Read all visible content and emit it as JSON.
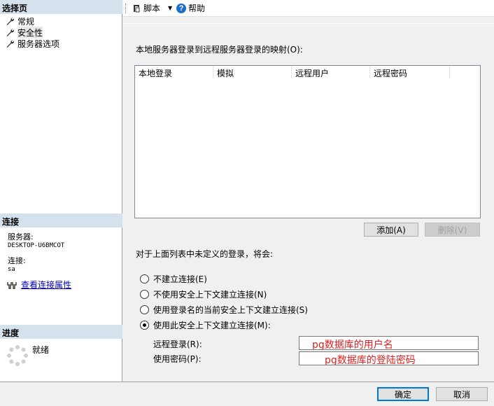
{
  "left_pane": {
    "select_page_title": "选择页",
    "pages": [
      {
        "label": "常规"
      },
      {
        "label": "安全性"
      },
      {
        "label": "服务器选项"
      }
    ],
    "connection": {
      "title": "连接",
      "server_label": "服务器:",
      "server_value": "DESKTOP-U6BMCOT",
      "conn_label": "连接:",
      "conn_value": "sa",
      "view_props_link": "查看连接属性"
    },
    "progress": {
      "title": "进度",
      "status": "就绪"
    }
  },
  "toolbar": {
    "script_label": "脚本",
    "help_label": "帮助"
  },
  "main": {
    "mapping_label": "本地服务器登录到远程服务器登录的映射(O):",
    "columns": [
      "本地登录",
      "模拟",
      "远程用户",
      "远程密码"
    ],
    "add_button": "添加(A)",
    "delete_button": "删除(V)",
    "undefined_label": "对于上面列表中未定义的登录，将会:",
    "options": [
      {
        "label": "不建立连接(E)",
        "checked": false
      },
      {
        "label": "不使用安全上下文建立连接(N)",
        "checked": false
      },
      {
        "label": "使用登录名的当前安全上下文建立连接(S)",
        "checked": false
      },
      {
        "label": "使用此安全上下文建立连接(M):",
        "checked": true
      }
    ],
    "remote_login_label": "远程登录(R):",
    "remote_login_value": "pg数据库的用户名",
    "password_label": "使用密码(P):",
    "password_value": "pg数据库的登陆密码"
  },
  "footer": {
    "ok_button": "确定",
    "cancel_button": "取消"
  },
  "colors": {
    "section_header_bg": "#d6e1ee",
    "annotation_text": "#e02020",
    "link": "#0000cc"
  }
}
